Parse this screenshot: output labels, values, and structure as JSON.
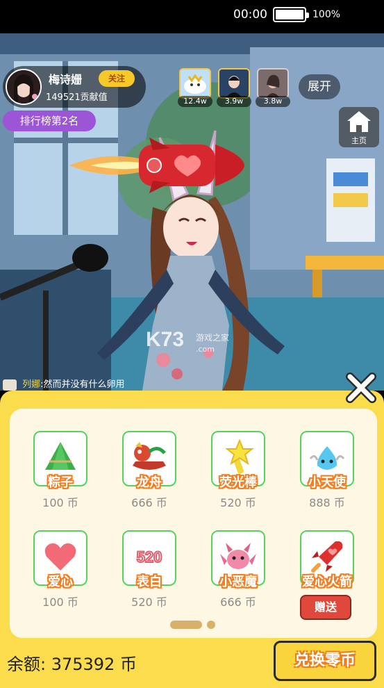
{
  "status_bar": {
    "time": "00:00",
    "battery": "100%"
  },
  "host": {
    "name": "梅诗姗",
    "contribution": "149521贡献值",
    "follow_label": "关注",
    "rank_label": "排行榜第2名"
  },
  "viewers": [
    {
      "count": "12.4w",
      "icon": "whale-avatar"
    },
    {
      "count": "3.9w",
      "icon": "user-avatar"
    },
    {
      "count": "3.8w",
      "icon": "user-avatar"
    }
  ],
  "expand_label": "展开",
  "home_label": "主页",
  "chat": {
    "user": "列娜",
    "message": ":然而并没有什么卵用"
  },
  "watermark": {
    "logo": "K73",
    "sub": "游戏之家",
    "domain": ".com"
  },
  "gifts": [
    {
      "name": "粽子",
      "price": "100 币",
      "icon": "zongzi-icon"
    },
    {
      "name": "龙舟",
      "price": "666 币",
      "icon": "dragon-boat-icon"
    },
    {
      "name": "荧光棒",
      "price": "520 币",
      "icon": "glow-stick-icon"
    },
    {
      "name": "小天使",
      "price": "888 币",
      "icon": "angel-icon"
    },
    {
      "name": "爱心",
      "price": "100 币",
      "icon": "heart-icon"
    },
    {
      "name": "表白",
      "price": "520 币",
      "icon": "confession-icon"
    },
    {
      "name": "小恶魔",
      "price": "666 币",
      "icon": "devil-icon"
    },
    {
      "name": "爱心火箭",
      "price": "",
      "icon": "rocket-icon"
    }
  ],
  "gift_520_text": "520",
  "send_label": "赠送",
  "balance_label": "余额: 375392 币",
  "exchange_label": "兑换零币",
  "colors": {
    "panel": "#fadc4c",
    "gift_border": "#52d65a",
    "gift_name_stroke": "#f57c1f",
    "send": "#e0483b",
    "rank": "#9b55d6"
  }
}
